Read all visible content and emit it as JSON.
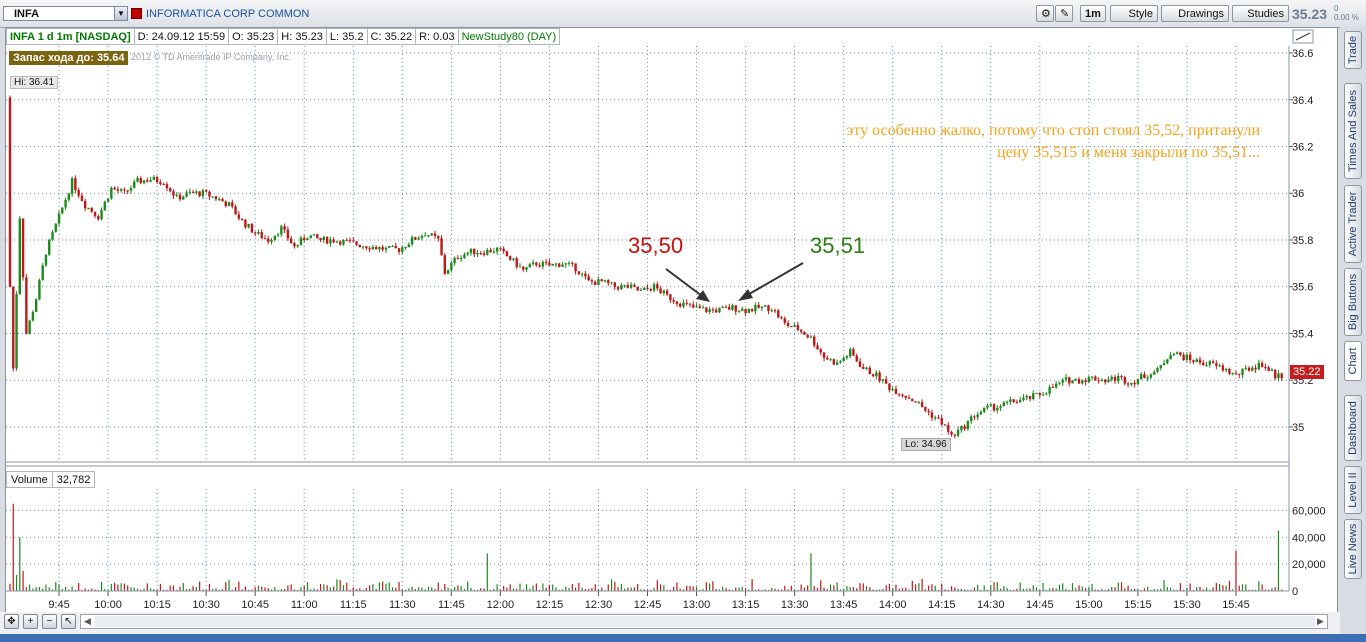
{
  "toolbar": {
    "symbol": "INFA",
    "company": "INFORMATICA CORP COMMON",
    "interval_btn": "1m",
    "style_btn": "Style",
    "drawings_btn": "Drawings",
    "studies_btn": "Studies",
    "last_price": "35.23",
    "change": "0",
    "change_pct": "0.00 %"
  },
  "header": {
    "title": "INFA 1 d 1m [NASDAQ]",
    "date": "D: 24.09.12 15:59",
    "open": "O: 35.23",
    "high": "H: 35.23",
    "low": "L: 35.2",
    "close": "C: 35.22",
    "range": "R: 0.03",
    "study": "NewStudy80 (DAY)"
  },
  "overlay": {
    "zapas": "Запас хода до: 35.64",
    "copyright": "2012 © TD Ameritrade IP Company, Inc.",
    "hi": "Hi: 36.41",
    "lo": "Lo: 34.96",
    "price_tag": "35.22",
    "note_line1": "эту особенно жалко, потому что стоп стоял 35,52, пританули",
    "note_line2": "цену 35,515 и меня закрыли по 35,51...",
    "ann_red": "35,50",
    "ann_green": "35,51"
  },
  "volume": {
    "label": "Volume",
    "value": "32,782"
  },
  "side_tabs": [
    "Trade",
    "Times And Sales",
    "Active Trader",
    "Big Buttons",
    "Chart",
    "Dashboard",
    "Level II",
    "Live News"
  ],
  "colors": {
    "up": "#1e8a1e",
    "down": "#c01818",
    "accent": "#3d6eb5",
    "note": "#f5a31a"
  },
  "chart_data": {
    "type": "candlestick",
    "title": "INFA 1 d 1m [NASDAQ]",
    "x_ticks": [
      "9:45",
      "10:00",
      "10:15",
      "10:30",
      "10:45",
      "11:00",
      "11:15",
      "11:30",
      "11:45",
      "12:00",
      "12:15",
      "12:30",
      "12:45",
      "13:00",
      "13:15",
      "13:30",
      "13:45",
      "14:00",
      "14:15",
      "14:30",
      "14:45",
      "15:00",
      "15:15",
      "15:30",
      "15:45"
    ],
    "y_ticks": [
      35,
      35.2,
      35.4,
      35.6,
      35.8,
      36,
      36.2,
      36.4,
      36.6
    ],
    "ylim": [
      34.85,
      36.63
    ],
    "time_range_minutes": [
      570,
      960
    ],
    "price_path": [
      [
        570,
        36.41
      ],
      [
        571,
        35.6
      ],
      [
        572,
        35.25
      ],
      [
        574,
        35.9
      ],
      [
        576,
        35.4
      ],
      [
        579,
        35.55
      ],
      [
        582,
        35.75
      ],
      [
        586,
        35.9
      ],
      [
        590,
        36.05
      ],
      [
        594,
        35.95
      ],
      [
        598,
        35.9
      ],
      [
        602,
        36.02
      ],
      [
        606,
        36.0
      ],
      [
        610,
        36.05
      ],
      [
        614,
        36.06
      ],
      [
        618,
        36.05
      ],
      [
        622,
        35.98
      ],
      [
        626,
        36.0
      ],
      [
        630,
        36.0
      ],
      [
        634,
        35.98
      ],
      [
        638,
        35.95
      ],
      [
        642,
        35.88
      ],
      [
        646,
        35.83
      ],
      [
        650,
        35.8
      ],
      [
        654,
        35.85
      ],
      [
        658,
        35.77
      ],
      [
        662,
        35.82
      ],
      [
        666,
        35.8
      ],
      [
        670,
        35.8
      ],
      [
        674,
        35.79
      ],
      [
        678,
        35.78
      ],
      [
        682,
        35.77
      ],
      [
        686,
        35.76
      ],
      [
        690,
        35.76
      ],
      [
        694,
        35.8
      ],
      [
        698,
        35.83
      ],
      [
        702,
        35.8
      ],
      [
        704,
        35.66
      ],
      [
        708,
        35.73
      ],
      [
        712,
        35.75
      ],
      [
        716,
        35.75
      ],
      [
        720,
        35.76
      ],
      [
        724,
        35.72
      ],
      [
        728,
        35.67
      ],
      [
        732,
        35.7
      ],
      [
        736,
        35.69
      ],
      [
        740,
        35.7
      ],
      [
        744,
        35.68
      ],
      [
        748,
        35.62
      ],
      [
        752,
        35.62
      ],
      [
        756,
        35.6
      ],
      [
        760,
        35.6
      ],
      [
        764,
        35.58
      ],
      [
        768,
        35.6
      ],
      [
        772,
        35.56
      ],
      [
        776,
        35.53
      ],
      [
        780,
        35.51
      ],
      [
        784,
        35.5
      ],
      [
        788,
        35.5
      ],
      [
        792,
        35.51
      ],
      [
        796,
        35.5
      ],
      [
        800,
        35.51
      ],
      [
        804,
        35.51
      ],
      [
        808,
        35.44
      ],
      [
        812,
        35.42
      ],
      [
        816,
        35.38
      ],
      [
        820,
        35.3
      ],
      [
        824,
        35.27
      ],
      [
        828,
        35.32
      ],
      [
        832,
        35.25
      ],
      [
        836,
        35.22
      ],
      [
        840,
        35.17
      ],
      [
        844,
        35.14
      ],
      [
        848,
        35.11
      ],
      [
        852,
        35.06
      ],
      [
        856,
        35.02
      ],
      [
        859,
        34.96
      ],
      [
        862,
        34.99
      ],
      [
        866,
        35.05
      ],
      [
        870,
        35.08
      ],
      [
        874,
        35.09
      ],
      [
        878,
        35.11
      ],
      [
        882,
        35.12
      ],
      [
        886,
        35.14
      ],
      [
        890,
        35.17
      ],
      [
        894,
        35.2
      ],
      [
        898,
        35.2
      ],
      [
        902,
        35.21
      ],
      [
        906,
        35.2
      ],
      [
        910,
        35.21
      ],
      [
        914,
        35.19
      ],
      [
        918,
        35.22
      ],
      [
        922,
        35.24
      ],
      [
        926,
        35.32
      ],
      [
        930,
        35.3
      ],
      [
        934,
        35.28
      ],
      [
        938,
        35.27
      ],
      [
        942,
        35.25
      ],
      [
        946,
        35.22
      ],
      [
        950,
        35.25
      ],
      [
        954,
        35.27
      ],
      [
        958,
        35.22
      ],
      [
        960,
        35.22
      ]
    ],
    "volume_ticks": [
      "0",
      "20,000",
      "40,000",
      "60,000"
    ],
    "volume_ylim": [
      0,
      70000
    ],
    "volume_spikes": [
      [
        570,
        5500
      ],
      [
        571,
        65000
      ],
      [
        572,
        12000
      ],
      [
        573,
        40000
      ],
      [
        574,
        15000
      ],
      [
        640,
        7000
      ],
      [
        716,
        28000
      ],
      [
        815,
        28000
      ],
      [
        945,
        30000
      ],
      [
        958,
        45000
      ]
    ]
  }
}
